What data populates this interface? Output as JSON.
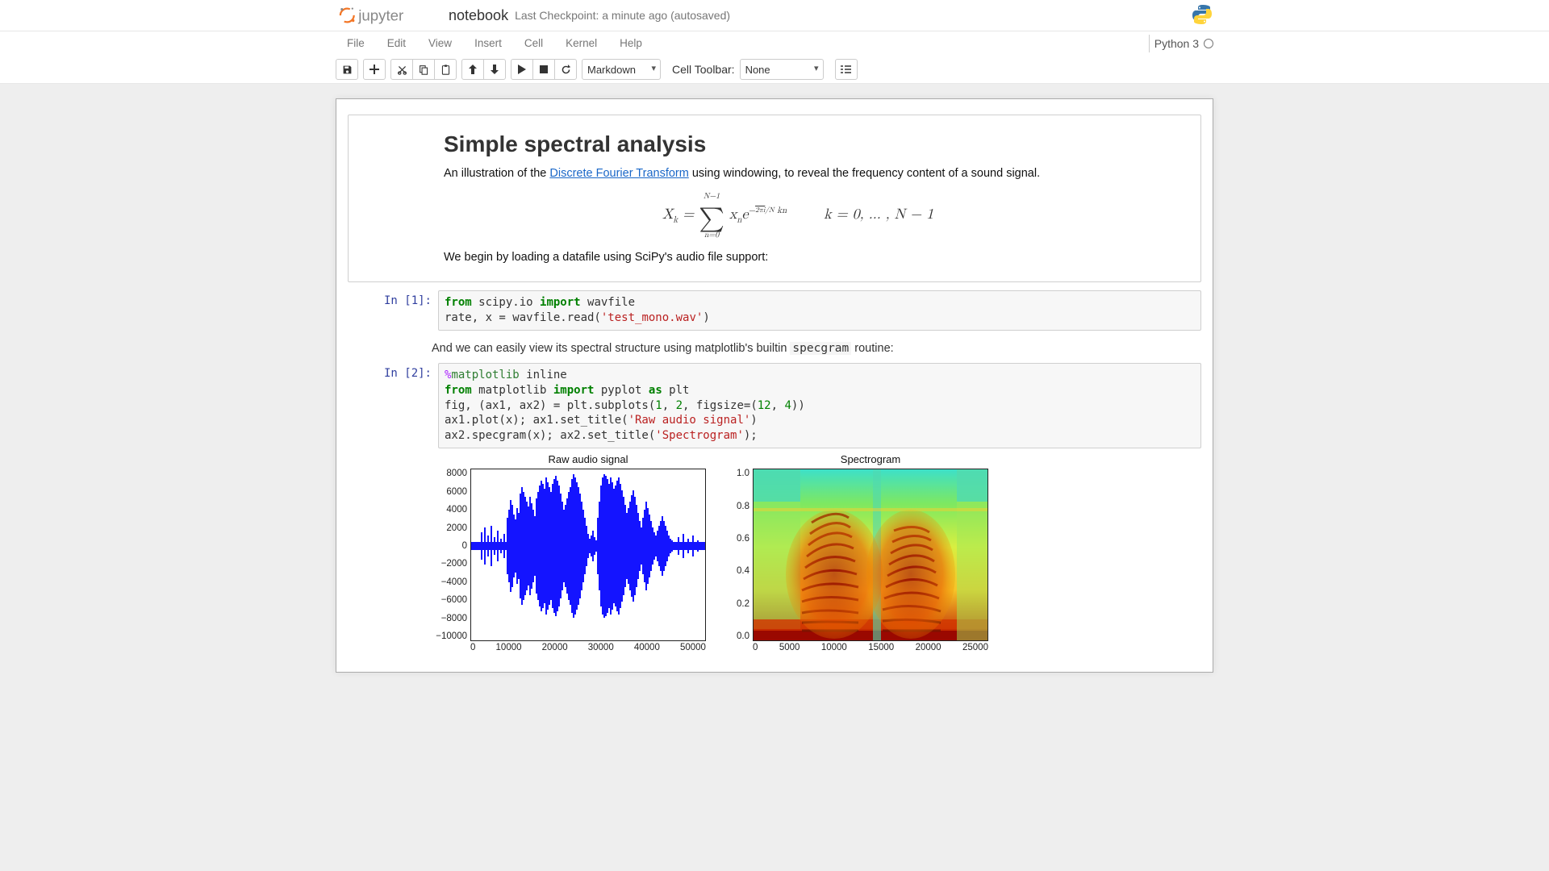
{
  "header": {
    "notebook_name": "notebook",
    "checkpoint": "Last Checkpoint: a minute ago (autosaved)"
  },
  "menubar": {
    "items": [
      "File",
      "Edit",
      "View",
      "Insert",
      "Cell",
      "Kernel",
      "Help"
    ],
    "kernel_name": "Python 3"
  },
  "toolbar": {
    "cell_type": "Markdown",
    "cell_toolbar_label": "Cell Toolbar:",
    "cell_toolbar_value": "None"
  },
  "cells": {
    "md1": {
      "title": "Simple spectral analysis",
      "p1_pre": "An illustration of the ",
      "p1_link": "Discrete Fourier Transform",
      "p1_post": " using windowing, to reveal the frequency content of a sound signal.",
      "p2": "We begin by loading a datafile using SciPy's audio file support:"
    },
    "code1": {
      "prompt": "In [1]:"
    },
    "md2": {
      "text_pre": "And we can easily view its spectral structure using matplotlib's builtin ",
      "code": "specgram",
      "text_post": " routine:"
    },
    "code2": {
      "prompt": "In [2]:"
    },
    "fig": {
      "title_left": "Raw audio signal",
      "title_right": "Spectrogram",
      "left_yticks": [
        "8000",
        "6000",
        "4000",
        "2000",
        "0",
        "−2000",
        "−4000",
        "−6000",
        "−8000",
        "−10000"
      ],
      "left_xticks": [
        "0",
        "10000",
        "20000",
        "30000",
        "40000",
        "50000"
      ],
      "right_yticks": [
        "1.0",
        "0.8",
        "0.6",
        "0.4",
        "0.2",
        "0.0"
      ],
      "right_xticks": [
        "0",
        "5000",
        "10000",
        "15000",
        "20000",
        "25000"
      ]
    }
  }
}
